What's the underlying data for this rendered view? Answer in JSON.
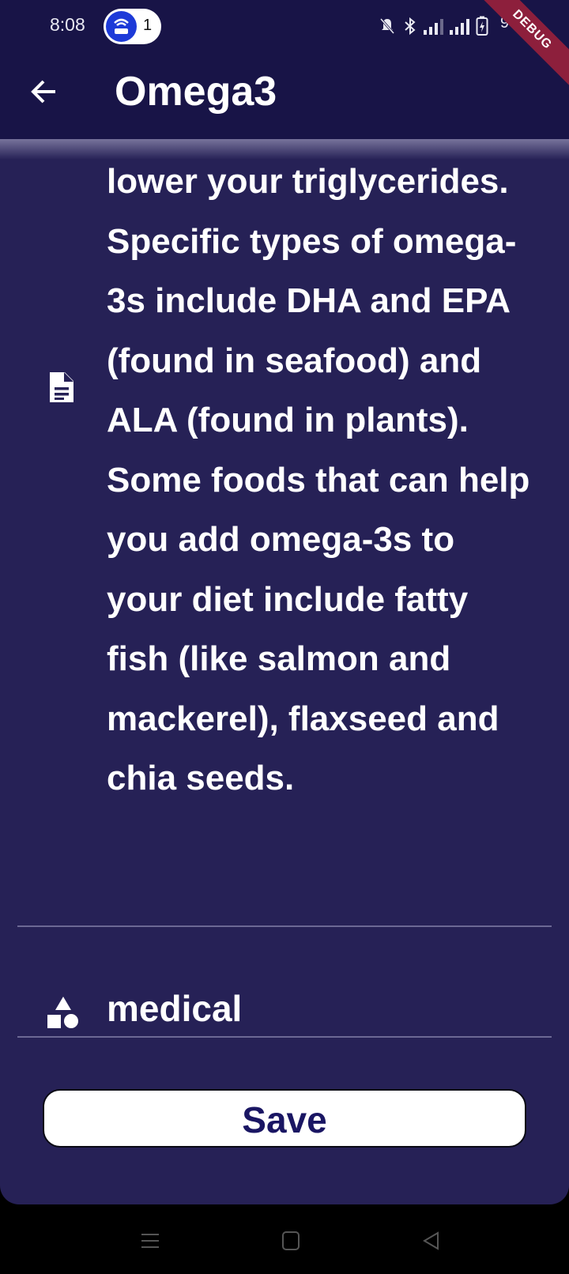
{
  "status_bar": {
    "time": "8:08",
    "hotspot_count": "1",
    "battery_text": "9",
    "debug_label": "DEBUG"
  },
  "app_bar": {
    "title": "Omega3",
    "back_icon": "arrow-left-icon"
  },
  "detail": {
    "description_icon": "document-icon",
    "description": "lower your triglycerides. Specific types of omega-3s include DHA and EPA (found in seafood) and ALA (found in plants). Some foods that can help you add omega-3s to your diet include fatty fish (like salmon and mackerel), flaxseed and chia seeds.",
    "category_icon": "shapes-icon",
    "category": "medical",
    "save_label": "Save"
  },
  "nav_bar": {
    "icons": [
      "menu-icon",
      "home-square-icon",
      "back-triangle-icon"
    ]
  },
  "colors": {
    "app_bar": "#181447",
    "card": "#262156",
    "save_text": "#1a1663",
    "debug_ribbon": "#8d1f3c"
  }
}
